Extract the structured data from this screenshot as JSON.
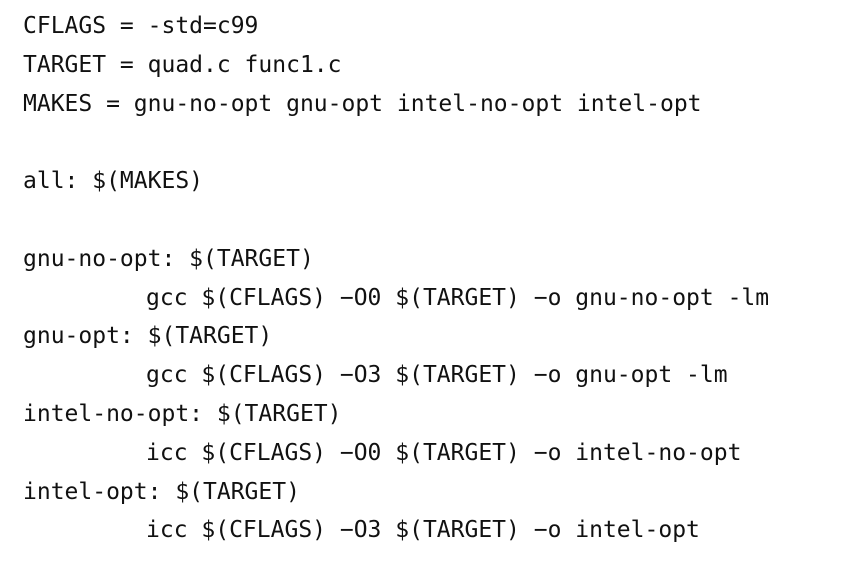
{
  "makefile": {
    "cflags": "CFLAGS = -std=c99",
    "target": "TARGET = quad.c func1.c",
    "makes": "MAKES = gnu-no-opt gnu-opt intel-no-opt intel-opt",
    "all": "all: $(MAKES)",
    "rules": [
      {
        "header": "gnu-no-opt: $(TARGET)",
        "command": "gcc $(CFLAGS) −O0 $(TARGET) −o gnu-no-opt -lm"
      },
      {
        "header": "gnu-opt: $(TARGET)",
        "command": "gcc $(CFLAGS) −O3 $(TARGET) −o gnu-opt -lm"
      },
      {
        "header": "intel-no-opt: $(TARGET)",
        "command": "icc $(CFLAGS) −O0 $(TARGET) −o intel-no-opt"
      },
      {
        "header": "intel-opt: $(TARGET)",
        "command": "icc $(CFLAGS) −O3 $(TARGET) −o intel-opt"
      }
    ]
  }
}
